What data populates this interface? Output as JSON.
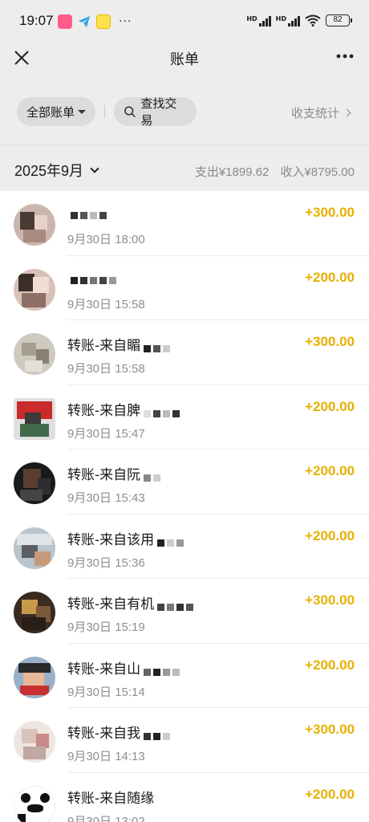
{
  "status_bar": {
    "time": "19:07",
    "battery": "82",
    "signal_label": "HD",
    "apps": [
      "video-app-icon",
      "telegram-icon",
      "sticker-app-icon"
    ],
    "more": "···"
  },
  "header": {
    "title": "账单",
    "close_icon": "close-icon",
    "more_icon": "more-icon"
  },
  "filters": {
    "all_bills": "全部账单",
    "search": "查找交易",
    "stats": "收支统计"
  },
  "month": {
    "label": "2025年9月",
    "expense": "支出¥1899.62",
    "income": "收入¥8795.00"
  },
  "transactions": [
    {
      "title": "",
      "time": "9月30日 18:00",
      "amount": "+300.00"
    },
    {
      "title": "",
      "time": "9月30日 15:58",
      "amount": "+200.00"
    },
    {
      "title": "转账-来自睸",
      "time": "9月30日 15:58",
      "amount": "+300.00"
    },
    {
      "title": "转账-来自脾",
      "time": "9月30日 15:47",
      "amount": "+200.00"
    },
    {
      "title": "转账-来自阮",
      "time": "9月30日 15:43",
      "amount": "+200.00"
    },
    {
      "title": "转账-来自该用",
      "time": "9月30日 15:36",
      "amount": "+200.00"
    },
    {
      "title": "转账-来自有机",
      "time": "9月30日 15:19",
      "amount": "+300.00"
    },
    {
      "title": "转账-来自山",
      "time": "9月30日 15:14",
      "amount": "+200.00"
    },
    {
      "title": "转账-来自我",
      "time": "9月30日 14:13",
      "amount": "+300.00"
    },
    {
      "title": "转账-来自随缘",
      "time": "9月30日 13:02",
      "amount": "+200.00"
    }
  ],
  "colors": {
    "background": "#ededed",
    "amount": "#e6b000",
    "muted": "#8f8f8f"
  }
}
